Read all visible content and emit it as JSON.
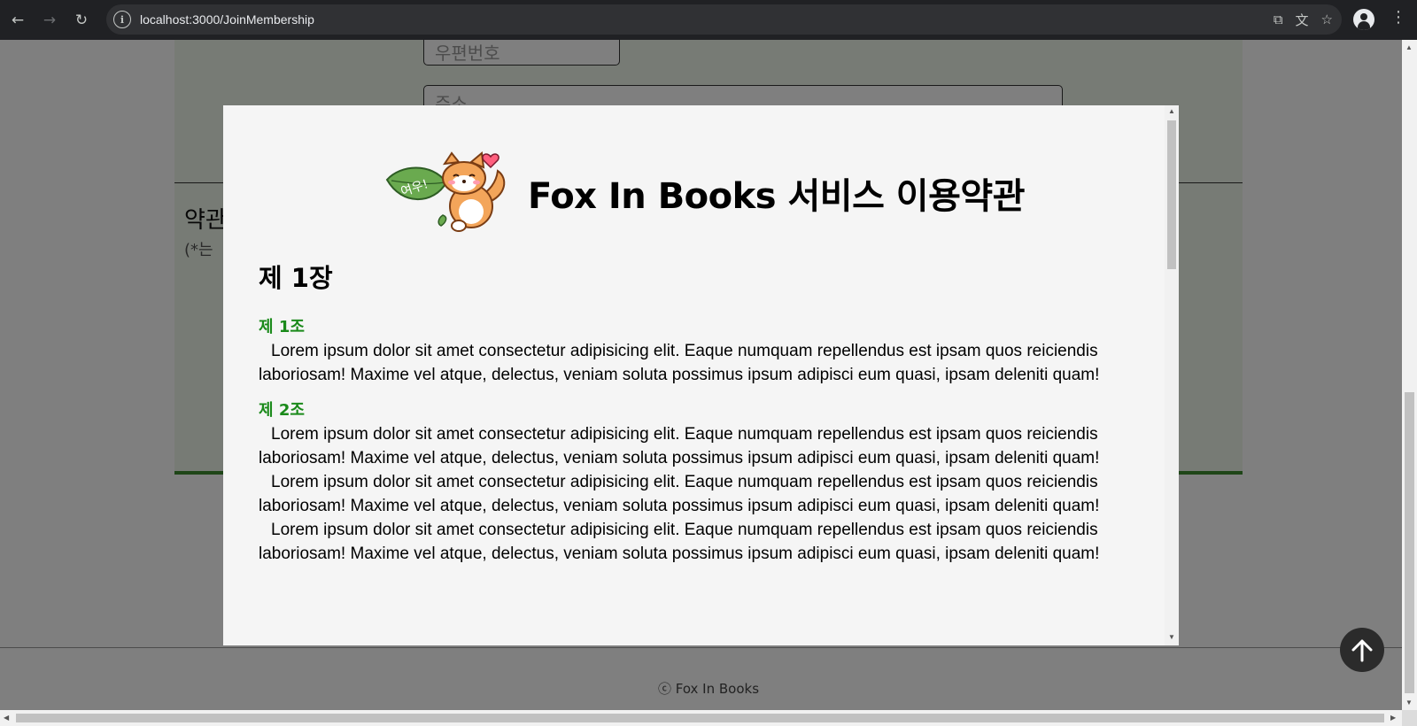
{
  "browser": {
    "url": "localhost:3000/JoinMembership",
    "back_icon": "arrow-left-icon",
    "forward_icon": "arrow-right-icon",
    "reload_icon": "reload-icon"
  },
  "page": {
    "postal_placeholder": "우편번호",
    "address_placeholder": "주소",
    "terms_heading": "약관",
    "terms_note": "(*는",
    "footer": "ⓒ Fox In Books"
  },
  "modal": {
    "title": "Fox In Books 서비스 이용약관",
    "mascot_leaf_text": "여우!",
    "chapter": "제 1장",
    "articles": [
      {
        "title": "제 1조",
        "paragraphs": [
          "Lorem ipsum dolor sit amet consectetur adipisicing elit. Eaque numquam repellendus est ipsam quos reiciendis laboriosam! Maxime vel atque, delectus, veniam soluta possimus ipsum adipisci eum quasi, ipsam deleniti quam!"
        ]
      },
      {
        "title": "제 2조",
        "paragraphs": [
          "Lorem ipsum dolor sit amet consectetur adipisicing elit. Eaque numquam repellendus est ipsam quos reiciendis laboriosam! Maxime vel atque, delectus, veniam soluta possimus ipsum adipisci eum quasi, ipsam deleniti quam!",
          "Lorem ipsum dolor sit amet consectetur adipisicing elit. Eaque numquam repellendus est ipsam quos reiciendis laboriosam! Maxime vel atque, delectus, veniam soluta possimus ipsum adipisci eum quasi, ipsam deleniti quam!",
          "Lorem ipsum dolor sit amet consectetur adipisicing elit. Eaque numquam repellendus est ipsam quos reiciendis laboriosam! Maxime vel atque, delectus, veniam soluta possimus ipsum adipisci eum quasi, ipsam deleniti quam!"
        ]
      }
    ]
  },
  "colors": {
    "article_title": "#1a8a1a",
    "accent_green": "#3c8a2e",
    "overlay": "rgba(0,0,0,0.5)"
  }
}
